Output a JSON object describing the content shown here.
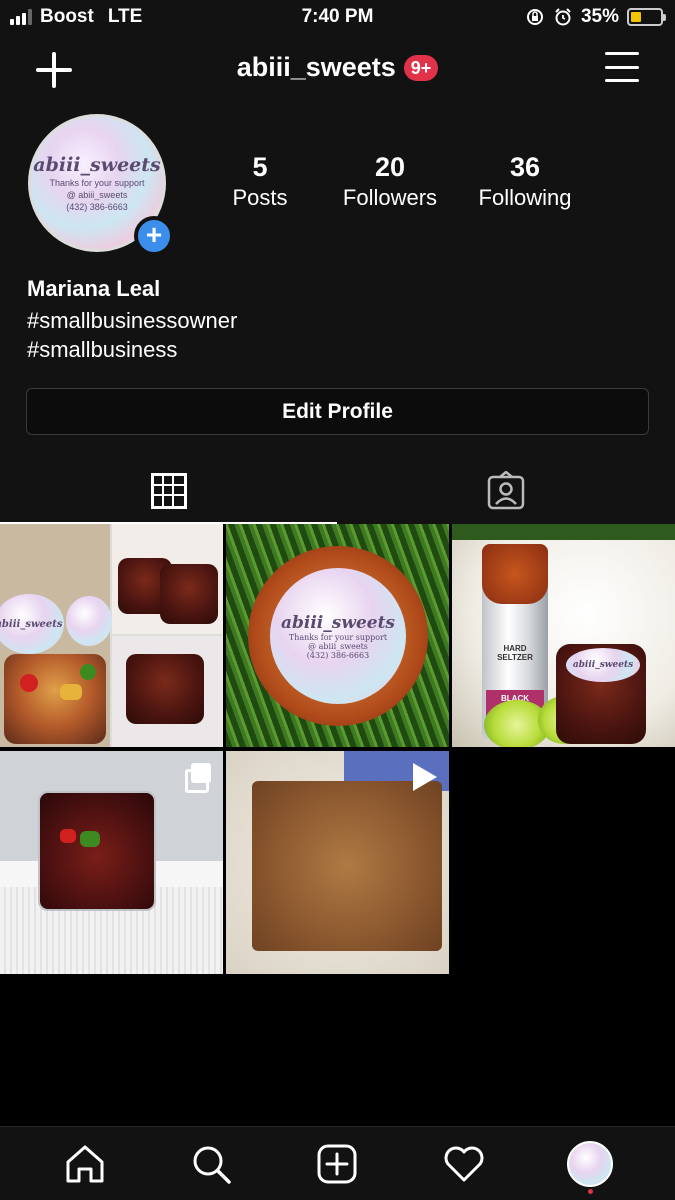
{
  "status_bar": {
    "carrier": "Boost",
    "network": "LTE",
    "time": "7:40 PM",
    "battery_percent": "35%",
    "battery_level": 0.35
  },
  "header": {
    "username": "abiii_sweets",
    "notification_badge": "9+"
  },
  "profile": {
    "avatar_text": "abiii_sweets",
    "avatar_lines": [
      "Thanks for your support",
      "@ abiii_sweets",
      "(432) 386-6663"
    ],
    "stats": [
      {
        "value": "5",
        "label": "Posts"
      },
      {
        "value": "20",
        "label": "Followers"
      },
      {
        "value": "36",
        "label": "Following"
      }
    ],
    "name": "Mariana Leal",
    "bio_tags": [
      "#smallbusinessowner",
      "#smallbusiness"
    ],
    "edit_button": "Edit Profile"
  },
  "tabs": [
    {
      "icon": "grid-icon",
      "active": true
    },
    {
      "icon": "tagged-person-icon",
      "active": false
    }
  ],
  "posts": [
    {
      "type": "photo",
      "sticker_text": "abiii_sweets"
    },
    {
      "type": "photo",
      "sticker_text": "abiii_sweets",
      "sticker_lines": [
        "Thanks for your support",
        "@ abiii_sweets",
        "(432) 386-6663"
      ]
    },
    {
      "type": "photo",
      "can_labels": [
        "HARD SELTZER",
        "BLACK CHERRY"
      ],
      "sticker_text": "abiii_sweets"
    },
    {
      "type": "carousel"
    },
    {
      "type": "video"
    }
  ],
  "bottom_nav": [
    "home-icon",
    "search-icon",
    "new-post-icon",
    "activity-heart-icon",
    "profile-avatar"
  ],
  "colors": {
    "background": "#000000",
    "surface": "#121212",
    "accent_blue": "#3b8fea",
    "badge_red": "#e0334a"
  }
}
